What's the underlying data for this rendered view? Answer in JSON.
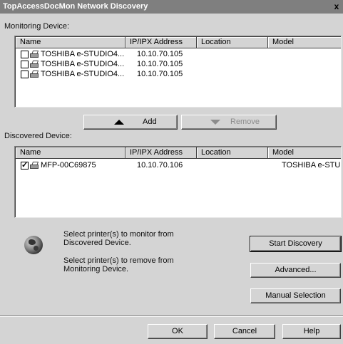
{
  "window": {
    "title": "TopAccessDocMon Network Discovery",
    "close_glyph": "x"
  },
  "monitoring": {
    "label": "Monitoring Device:",
    "columns": [
      "Name",
      "IP/IPX Address",
      "Location",
      "Model"
    ],
    "rows": [
      {
        "checked": false,
        "name": "TOSHIBA e-STUDIO4...",
        "ip": "10.10.70.105",
        "location": "",
        "model": ""
      },
      {
        "checked": false,
        "name": "TOSHIBA e-STUDIO4...",
        "ip": "10.10.70.105",
        "location": "",
        "model": ""
      },
      {
        "checked": false,
        "name": "TOSHIBA e-STUDIO4...",
        "ip": "10.10.70.105",
        "location": "",
        "model": ""
      }
    ]
  },
  "buttons": {
    "add": "Add",
    "remove": "Remove",
    "start_discovery": "Start Discovery",
    "advanced": "Advanced...",
    "manual_selection": "Manual Selection",
    "ok": "OK",
    "cancel": "Cancel",
    "help": "Help"
  },
  "discovered": {
    "label": "Discovered Device:",
    "columns": [
      "Name",
      "IP/IPX Address",
      "Location",
      "Model"
    ],
    "rows": [
      {
        "checked": true,
        "name": "MFP-00C69875",
        "ip": "10.10.70.106",
        "location": "",
        "model": "TOSHIBA e-STU..."
      }
    ]
  },
  "info": {
    "monitor_hint_line1": "Select printer(s) to monitor from",
    "monitor_hint_line2": "Discovered Device.",
    "remove_hint_line1": "Select printer(s) to remove from",
    "remove_hint_line2": "Monitoring Device."
  },
  "icons": {
    "globe": "globe-icon",
    "printer": "printer-icon",
    "up": "arrow-up-icon",
    "down": "arrow-down-icon"
  },
  "colors": {
    "dialog_bg": "#d4d4d4",
    "titlebar_bg": "#7f7f7f",
    "disabled_text": "#8c8c8c"
  }
}
